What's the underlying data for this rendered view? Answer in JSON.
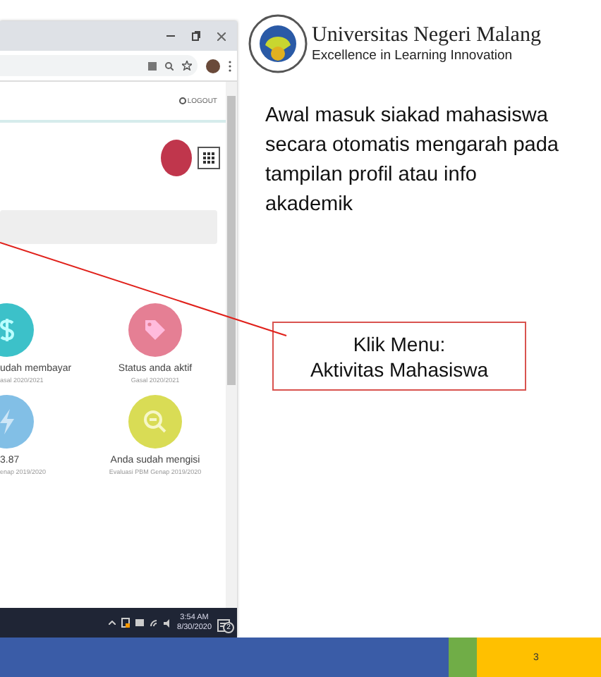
{
  "browser": {
    "logout": "LOGOUT",
    "cards": [
      {
        "kind": "dollar",
        "color": "#3cc1c9",
        "label": "udah membayar",
        "sub": "asal 2020/2021"
      },
      {
        "kind": "tag",
        "color": "#e57f94",
        "label": "Status anda aktif",
        "sub": "Gasal 2020/2021"
      },
      {
        "kind": "bolt",
        "color": "#82bfe6",
        "label": "3.87",
        "sub": "enap 2019/2020"
      },
      {
        "kind": "search",
        "color": "#d9dc55",
        "label": "Anda sudah mengisi",
        "sub": "Evaluasi PBM Genap 2019/2020"
      }
    ],
    "taskbar": {
      "time": "3:54 AM",
      "date": "8/30/2020",
      "notifications": "2"
    }
  },
  "header": {
    "university": "Universitas Negeri Malang",
    "tagline": "Excellence in Learning Innovation"
  },
  "description": "Awal masuk siakad mahasiswa secara otomatis mengarah pada tampilan profil atau info akademik",
  "callout": {
    "lines": [
      "Klik Menu:",
      "Aktivitas Mahasiswa"
    ]
  },
  "footer": {
    "page": "3"
  }
}
